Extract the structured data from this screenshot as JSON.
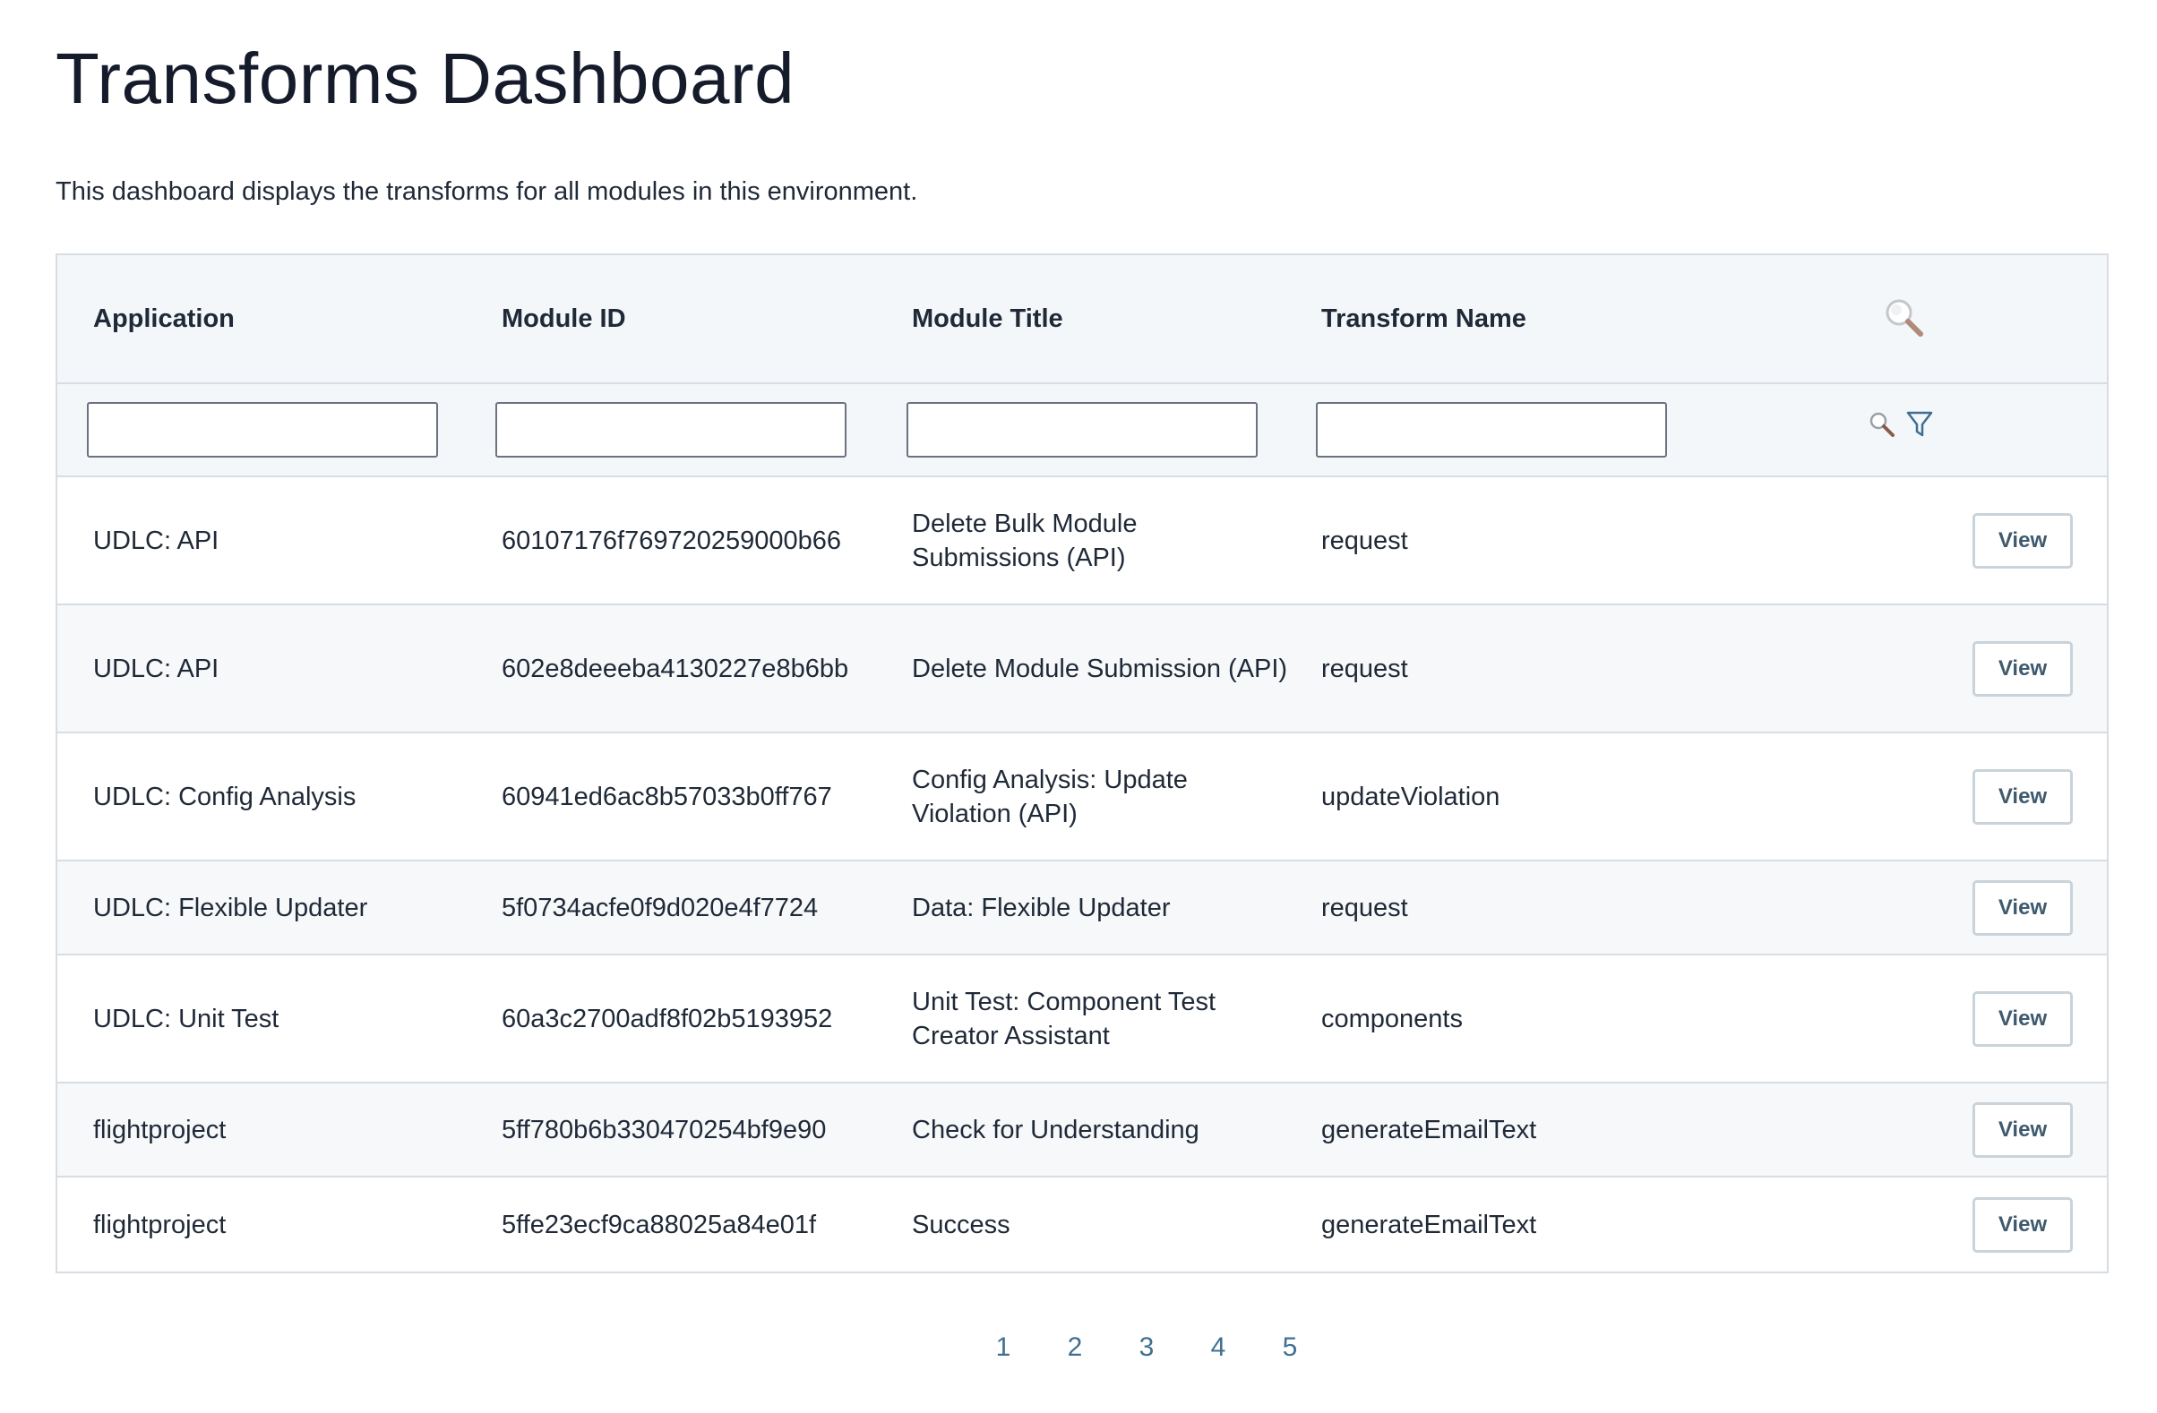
{
  "page": {
    "title": "Transforms Dashboard",
    "description": "This dashboard displays the transforms for all modules in this environment."
  },
  "table": {
    "columns": [
      "Application",
      "Module ID",
      "Module Title",
      "Transform Name"
    ],
    "filters": {
      "application": "",
      "module_id": "",
      "module_title": "",
      "transform_name": ""
    },
    "action_label": "View",
    "rows": [
      {
        "application": "UDLC: API",
        "module_id": "60107176f769720259000b66",
        "module_title": "Delete Bulk Module Submissions (API)",
        "transform_name": "request"
      },
      {
        "application": "UDLC: API",
        "module_id": "602e8deeeba4130227e8b6bb",
        "module_title": "Delete Module Submission (API)",
        "transform_name": "request"
      },
      {
        "application": "UDLC: Config Analysis",
        "module_id": "60941ed6ac8b57033b0ff767",
        "module_title": "Config Analysis: Update Violation (API)",
        "transform_name": "updateViolation"
      },
      {
        "application": "UDLC: Flexible Updater",
        "module_id": "5f0734acfe0f9d020e4f7724",
        "module_title": "Data: Flexible Updater",
        "transform_name": "request"
      },
      {
        "application": "UDLC: Unit Test",
        "module_id": "60a3c2700adf8f02b5193952",
        "module_title": "Unit Test: Component Test Creator Assistant",
        "transform_name": "components"
      },
      {
        "application": "flightproject",
        "module_id": "5ff780b6b330470254bf9e90",
        "module_title": "Check for Understanding",
        "transform_name": "generateEmailText"
      },
      {
        "application": "flightproject",
        "module_id": "5ffe23ecf9ca88025a84e01f",
        "module_title": "Success",
        "transform_name": "generateEmailText"
      }
    ]
  },
  "pagination": {
    "pages": [
      "1",
      "2",
      "3",
      "4",
      "5"
    ]
  },
  "colors": {
    "header_bg": "#f4f7f9",
    "border": "#d7dde2",
    "link": "#3f6f92",
    "button_text": "#3f5a6e"
  },
  "icons": {
    "header_search": "search-icon",
    "filter_search": "search-icon",
    "filter": "filter-icon"
  }
}
